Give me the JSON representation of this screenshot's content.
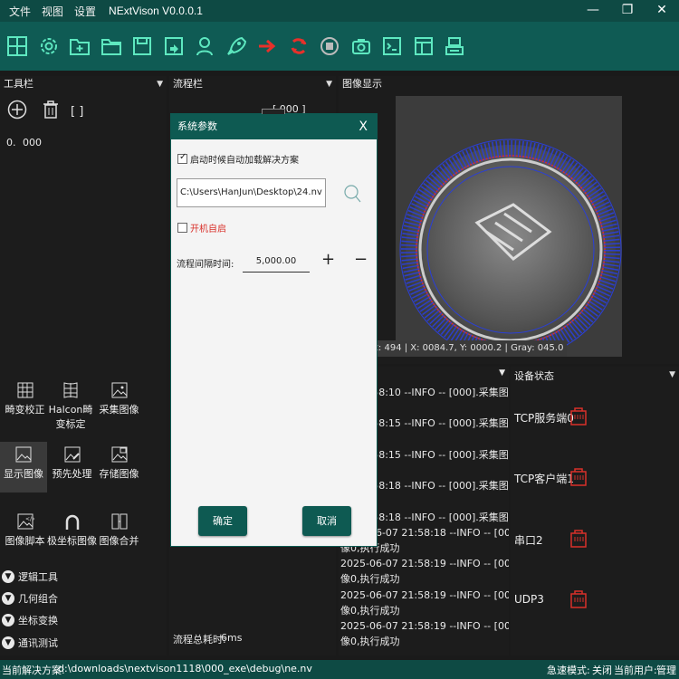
{
  "window": {
    "menu": [
      "文件",
      "视图",
      "设置"
    ],
    "title": "NExtVison V0.0.0.1",
    "minimize_label": "—",
    "maximize_label": "❐",
    "close_label": "✕"
  },
  "toolbar": {
    "icons": [
      "grid-icon",
      "gear-icon",
      "new-folder-icon",
      "open-folder-icon",
      "save-icon",
      "save-as-icon",
      "user-icon",
      "rocket-icon",
      "run-once-icon",
      "run-loop-icon",
      "stop-icon",
      "camera-icon",
      "terminal-icon",
      "layout-icon",
      "network-icon"
    ]
  },
  "tools_panel": {
    "title": "工具栏",
    "bracket_label": "[ ]",
    "entry_index": "0.",
    "entry_value": "000",
    "items": [
      {
        "label": "畸变校正"
      },
      {
        "label": "Halcon畸变标定"
      },
      {
        "label": "采集图像"
      },
      {
        "label": "显示图像"
      },
      {
        "label": "预先处理"
      },
      {
        "label": "存储图像"
      },
      {
        "label": "图像脚本"
      },
      {
        "label": "极坐标图像"
      },
      {
        "label": "图像合并"
      }
    ],
    "groups": [
      "逻辑工具",
      "几何组合",
      "坐标变换",
      "通讯测试"
    ]
  },
  "flow_panel": {
    "title": "流程栏",
    "partial_text": "[ 000 ]",
    "total_time_label": "流程总耗时:",
    "total_time_value": "6ms"
  },
  "image_panel": {
    "title": "图像显示",
    "readout": "t: 494 | X: 0084.7, Y: 0000.2 | Gray: 045.0"
  },
  "log_panel": {
    "lines": [
      "07 21:58:10 --INFO -- [000].采集图",
      "功",
      "07 21:58:15 --INFO -- [000].采集图",
      "功",
      "07 21:58:15 --INFO -- [000].采集图",
      "功",
      "07 21:58:18 --INFO -- [000].采集图",
      "功",
      "07 21:58:18 --INFO -- [000].采集图",
      "2025-06-07 21:58:18 --INFO -- [000].采集图",
      "像0,执行成功",
      "2025-06-07 21:58:19 --INFO -- [000].采集图",
      "像0,执行成功",
      "2025-06-07 21:58:19 --INFO -- [000].采集图",
      "像0,执行成功",
      "2025-06-07 21:58:19 --INFO -- [000].采集图",
      "像0,执行成功"
    ]
  },
  "device_panel": {
    "title": "设备状态",
    "devices": [
      {
        "label": "TCP服务端0"
      },
      {
        "label": "TCP客户端1"
      },
      {
        "label": "串口2"
      },
      {
        "label": "UDP3"
      }
    ]
  },
  "status_bar": {
    "solution_label": "当前解决方案:",
    "solution_path": "d:\\downloads\\nextvison1118\\000_exe\\debug\\ne.nv",
    "fast_mode_label": "急速模式:",
    "fast_mode_value": "关闭",
    "user_label": "当前用户:",
    "user_value": "管理员"
  },
  "dialog": {
    "title": "系统参数",
    "close_label": "X",
    "autoload_checked": true,
    "autoload_label": "启动时候自动加载解决方案",
    "path_value": "C:\\Users\\HanJun\\Desktop\\24.nv",
    "autostart_checked": false,
    "autostart_label": "开机自启",
    "interval_label": "流程间隔时间:",
    "interval_value": "5,000.00",
    "plus_label": "+",
    "minus_label": "−",
    "ok_label": "确定",
    "cancel_label": "取消"
  },
  "colors": {
    "title_bar": "#0e4a44",
    "toolbar": "#0f5b54",
    "dialog_accent": "#0e5a52",
    "error_red": "#d9302a"
  }
}
